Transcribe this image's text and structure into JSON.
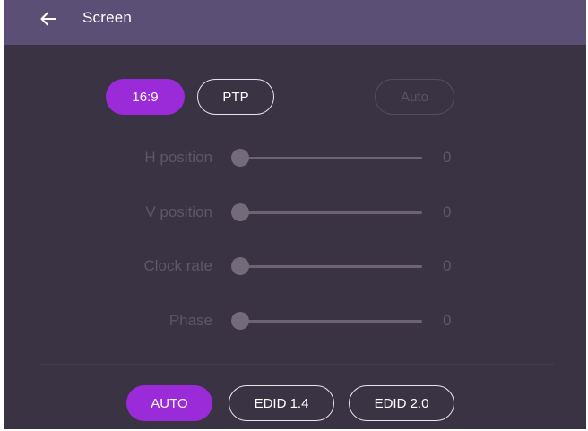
{
  "header": {
    "title": "Screen",
    "back_icon": "arrow-left-icon"
  },
  "aspect": {
    "options": [
      {
        "label": "16:9",
        "state": "active"
      },
      {
        "label": "PTP",
        "state": "outline"
      }
    ],
    "auto_label": "Auto"
  },
  "adjustments": [
    {
      "label": "H position",
      "value": "0",
      "level": 0
    },
    {
      "label": "V position",
      "value": "0",
      "level": 0
    },
    {
      "label": "Clock rate",
      "value": "0",
      "level": 0
    },
    {
      "label": "Phase",
      "value": "0",
      "level": 0
    }
  ],
  "edid": {
    "options": [
      {
        "label": "AUTO",
        "state": "active"
      },
      {
        "label": "EDID 1.4",
        "state": "outline"
      },
      {
        "label": "EDID 2.0",
        "state": "outline"
      }
    ]
  },
  "colors": {
    "accent": "#9b2ad8",
    "header": "#5c4f76",
    "background": "#3a3343"
  }
}
